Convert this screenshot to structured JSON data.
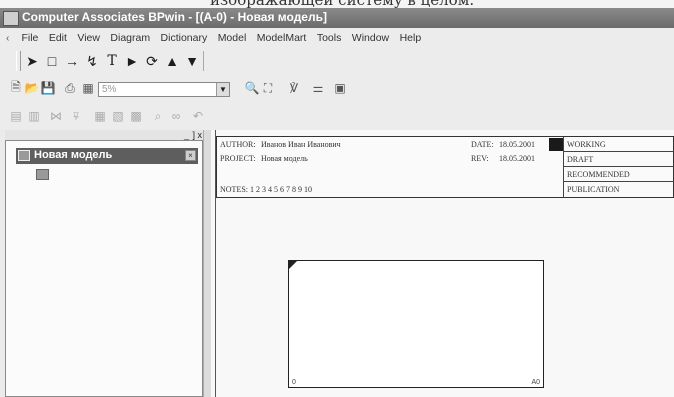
{
  "caption": "изображающей систему в целом.",
  "window": {
    "title": "Computer Associates BPwin - [(A-0) - Новая модель]"
  },
  "menu": {
    "items": [
      "File",
      "Edit",
      "View",
      "Diagram",
      "Dictionary",
      "Model",
      "ModelMart",
      "Tools",
      "Window",
      "Help"
    ]
  },
  "toolbar2": {
    "combo_value": "5%"
  },
  "explorer": {
    "model_label": "Новая модель"
  },
  "frame": {
    "author_label": "AUTHOR:",
    "author_value": "Иванов Иван Иванович",
    "project_label": "PROJECT:",
    "project_value": "Новая модель",
    "date_label": "DATE:",
    "date_value": "18.05.2001",
    "rev_label": "REV:",
    "rev_value": "18.05.2001",
    "notes": "NOTES:  1  2  3  4  5  6  7  8  9  10",
    "status": [
      "WORKING",
      "DRAFT",
      "RECOMMENDED",
      "PUBLICATION"
    ]
  },
  "context_box": {
    "bl": "0",
    "br": "A0"
  },
  "icons": [
    "app-icon",
    "mdi-restore-icon",
    "pointer-icon",
    "box-icon",
    "arrow-icon",
    "squiggle-icon",
    "text-tool-icon",
    "play-icon",
    "rotate-icon",
    "triangle-up-icon",
    "triangle-down-icon",
    "new-icon",
    "open-icon",
    "save-icon",
    "print-icon",
    "model-explorer-icon",
    "zoom-icon",
    "fit-icon",
    "spell-icon",
    "report-icon",
    "close-model-icon"
  ]
}
